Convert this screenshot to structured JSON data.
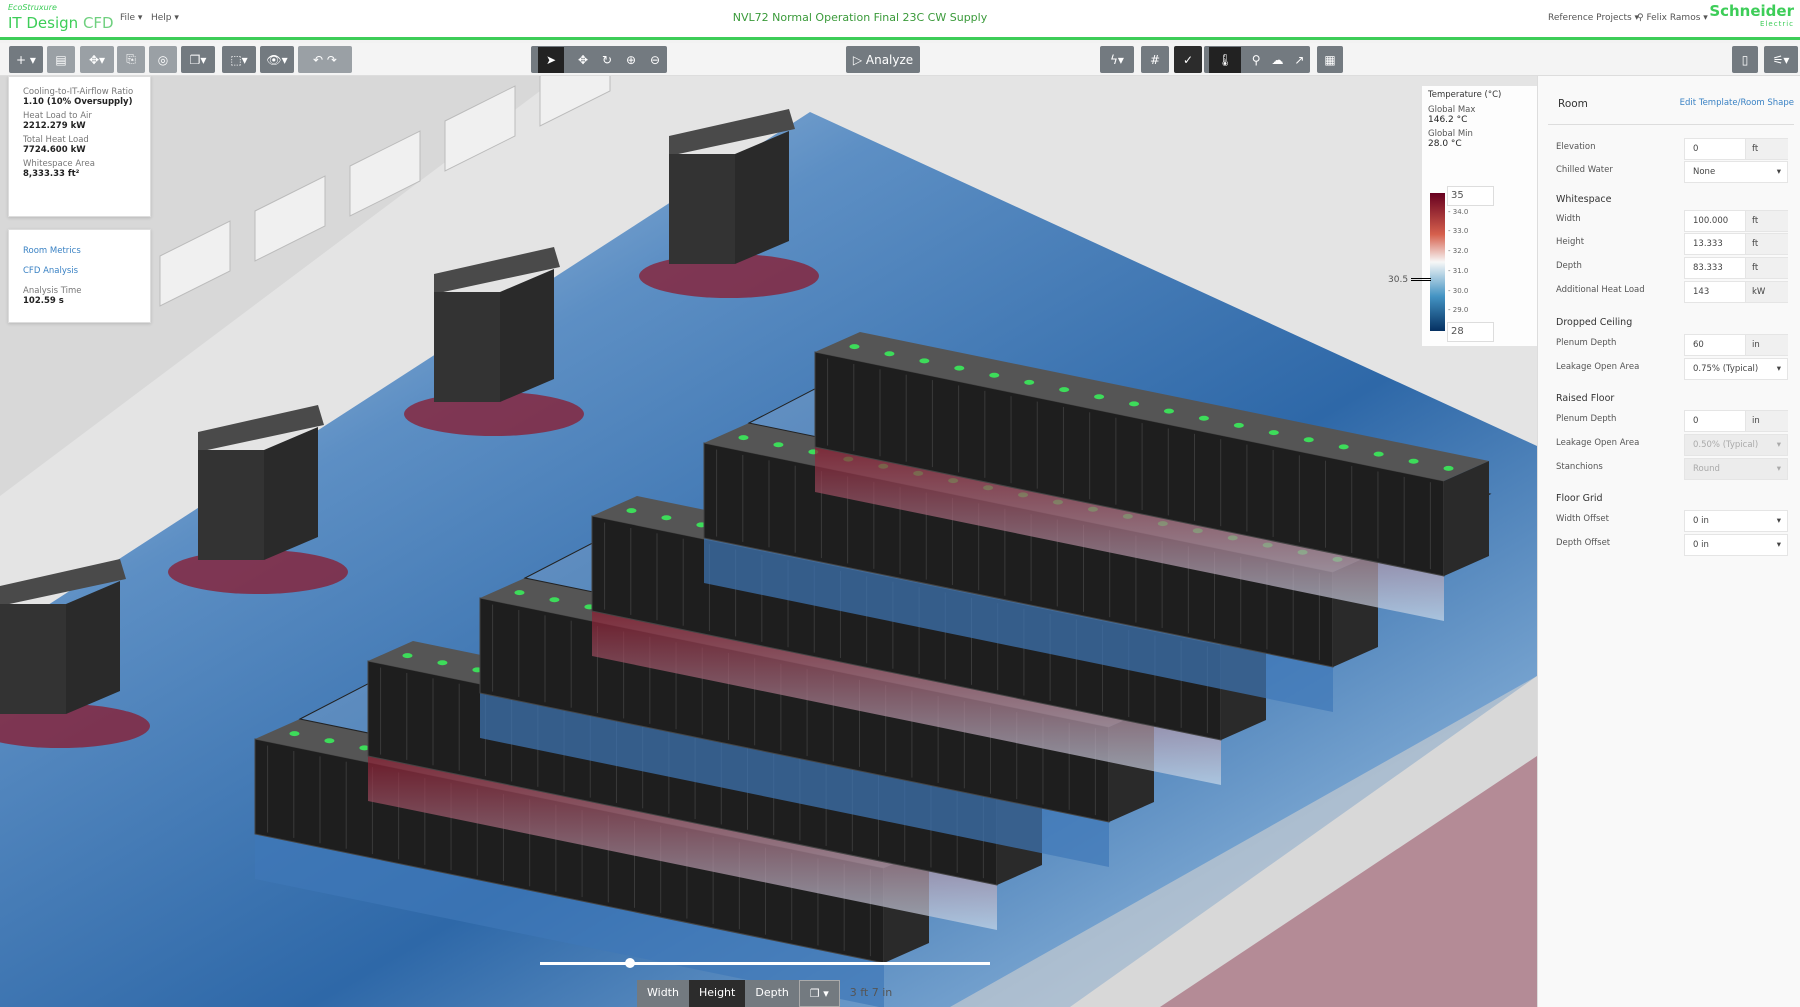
{
  "header": {
    "brand_small": "EcoStruxure",
    "brand_main": "IT Design",
    "brand_suffix": "CFD",
    "menus": [
      "File ▾",
      "Help ▾"
    ],
    "title": "NVL72 Normal Operation Final 23C CW Supply",
    "reference_projects": "Reference Projects ▾",
    "user": "Felix Ramos ▾",
    "logo_main": "Schneider",
    "logo_sub": "Electric"
  },
  "toolbar": {
    "analyze": "Analyze"
  },
  "metrics": {
    "items": [
      {
        "label": "Cooling-to-IT-Airflow Ratio",
        "value": "1.10  (10% Oversupply)"
      },
      {
        "label": "Heat Load to Air",
        "value": "2212.279 kW"
      },
      {
        "label": "Total Heat Load",
        "value": "7724.600 kW"
      },
      {
        "label": "Whitespace Area",
        "value": "8,333.33 ft²"
      }
    ]
  },
  "links": {
    "room_metrics": "Room Metrics",
    "cfd_analysis": "CFD Analysis",
    "analysis_time_label": "Analysis Time",
    "analysis_time": "102.59 s"
  },
  "legend": {
    "title": "Temperature (°C)",
    "max_label": "Global Max",
    "max": "146.2 °C",
    "min_label": "Global Min",
    "min": "28.0 °C",
    "top": "35",
    "bottom": "28",
    "ticks": [
      "34.0",
      "33.0",
      "32.0",
      "31.0",
      "30.0",
      "29.0"
    ],
    "marker": "30.5",
    "marker_value": 30.5,
    "range": [
      28,
      35
    ]
  },
  "bottom": {
    "width": "Width",
    "height": "Height",
    "depth": "Depth",
    "measure": "3 ft 7 in",
    "slider_fraction": 0.2
  },
  "panel": {
    "title": "Room",
    "edit_link": "Edit Template/Room Shape",
    "elevation": {
      "label": "Elevation",
      "value": "0",
      "unit": "ft"
    },
    "chilled_water": {
      "label": "Chilled Water",
      "value": "None"
    },
    "whitespace": {
      "title": "Whitespace",
      "width": {
        "label": "Width",
        "value": "100.000",
        "unit": "ft"
      },
      "height": {
        "label": "Height",
        "value": "13.333",
        "unit": "ft"
      },
      "depth": {
        "label": "Depth",
        "value": "83.333",
        "unit": "ft"
      },
      "heat": {
        "label": "Additional Heat Load",
        "value": "143",
        "unit": "kW"
      }
    },
    "dropped": {
      "title": "Dropped Ceiling",
      "plenum": {
        "label": "Plenum Depth",
        "value": "60",
        "unit": "in"
      },
      "leak": {
        "label": "Leakage Open Area",
        "value": "0.75%  (Typical)"
      }
    },
    "raised": {
      "title": "Raised Floor",
      "plenum": {
        "label": "Plenum Depth",
        "value": "0",
        "unit": "in"
      },
      "leak": {
        "label": "Leakage Open Area",
        "value": "0.50%  (Typical)"
      },
      "stanchions": {
        "label": "Stanchions",
        "value": "Round"
      }
    },
    "grid": {
      "title": "Floor Grid",
      "width": {
        "label": "Width Offset",
        "value": "0 in"
      },
      "depth": {
        "label": "Depth Offset",
        "value": "0 in"
      }
    }
  },
  "colors": {
    "accent": "#3dcd58",
    "link": "#3a82c4",
    "hot": "#8b1a2e",
    "cold": "#2d6fb0"
  }
}
